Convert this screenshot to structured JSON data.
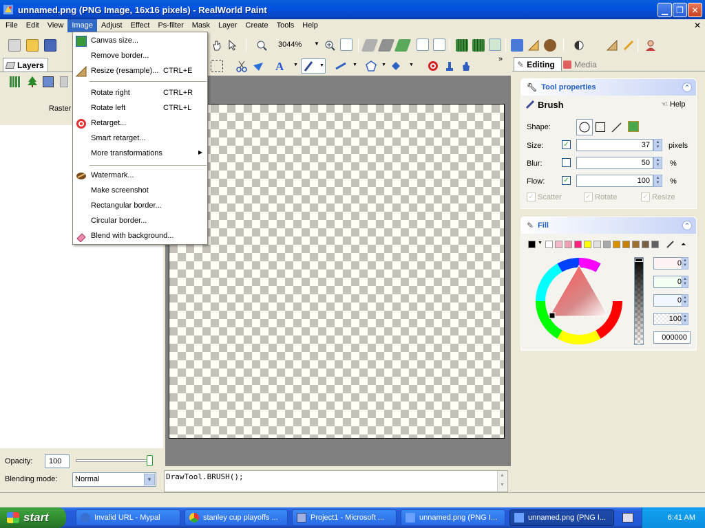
{
  "window": {
    "title": "unnamed.png (PNG Image, 16x16 pixels) - RealWorld Paint"
  },
  "menubar": [
    "File",
    "Edit",
    "View",
    "Image",
    "Adjust",
    "Effect",
    "Ps-filter",
    "Mask",
    "Layer",
    "Create",
    "Tools",
    "Help"
  ],
  "toolbar": {
    "zoom": "3044%"
  },
  "layers_panel": {
    "tab_label": "Layers",
    "layer_name": "Raster",
    "opacity_label": "Opacity:",
    "opacity_value": "100",
    "blend_label": "Blending mode:",
    "blend_value": "Normal"
  },
  "image_menu": [
    {
      "label": "Canvas size...",
      "shortcut": ""
    },
    {
      "label": "Remove border...",
      "shortcut": ""
    },
    {
      "label": "Resize (resample)...",
      "shortcut": "CTRL+E"
    },
    {
      "label": "Rotate right",
      "shortcut": "CTRL+R"
    },
    {
      "label": "Rotate left",
      "shortcut": "CTRL+L"
    },
    {
      "label": "Retarget...",
      "shortcut": ""
    },
    {
      "label": "Smart retarget...",
      "shortcut": ""
    },
    {
      "label": "More transformations",
      "shortcut": ""
    },
    {
      "label": "Watermark...",
      "shortcut": ""
    },
    {
      "label": "Make screenshot",
      "shortcut": ""
    },
    {
      "label": "Rectangular border...",
      "shortcut": ""
    },
    {
      "label": "Circular border...",
      "shortcut": ""
    },
    {
      "label": "Blend with background...",
      "shortcut": ""
    }
  ],
  "script": "DrawTool.BRUSH();",
  "right_tabs": {
    "editing": "Editing",
    "media": "Media"
  },
  "tool_properties": {
    "header": "Tool properties",
    "tool_name": "Brush",
    "help": "Help",
    "shape_label": "Shape:",
    "size_label": "Size:",
    "size_value": "37",
    "size_unit": "pixels",
    "blur_label": "Blur:",
    "blur_value": "50",
    "blur_unit": "%",
    "flow_label": "Flow:",
    "flow_value": "100",
    "flow_unit": "%",
    "scatter": "Scatter",
    "rotate": "Rotate",
    "resize": "Resize"
  },
  "fill": {
    "header": "Fill",
    "swatches": [
      "#000000",
      "#ffffff",
      "#f0b8c8",
      "#f0a0b4",
      "#ff2080",
      "#ffff00",
      "#e0e0e0",
      "#a8a8a8",
      "#d89000",
      "#c88000",
      "#a07030",
      "#786040",
      "#606060"
    ],
    "values": [
      "0",
      "0",
      "0",
      "100"
    ],
    "hex": "000000"
  },
  "taskbar": {
    "start": "start",
    "buttons": [
      "Invalid URL - Mypal",
      "stanley cup playoffs ...",
      "Project1 - Microsoft ...",
      "unnamed.png (PNG I...",
      "unnamed.png (PNG I..."
    ],
    "time": "6:41 AM"
  },
  "colors": {
    "accent": "#316ac5",
    "title_blue": "#0353e1",
    "taskbar_blue": "#245edb",
    "start_green": "#2f8a2f"
  }
}
